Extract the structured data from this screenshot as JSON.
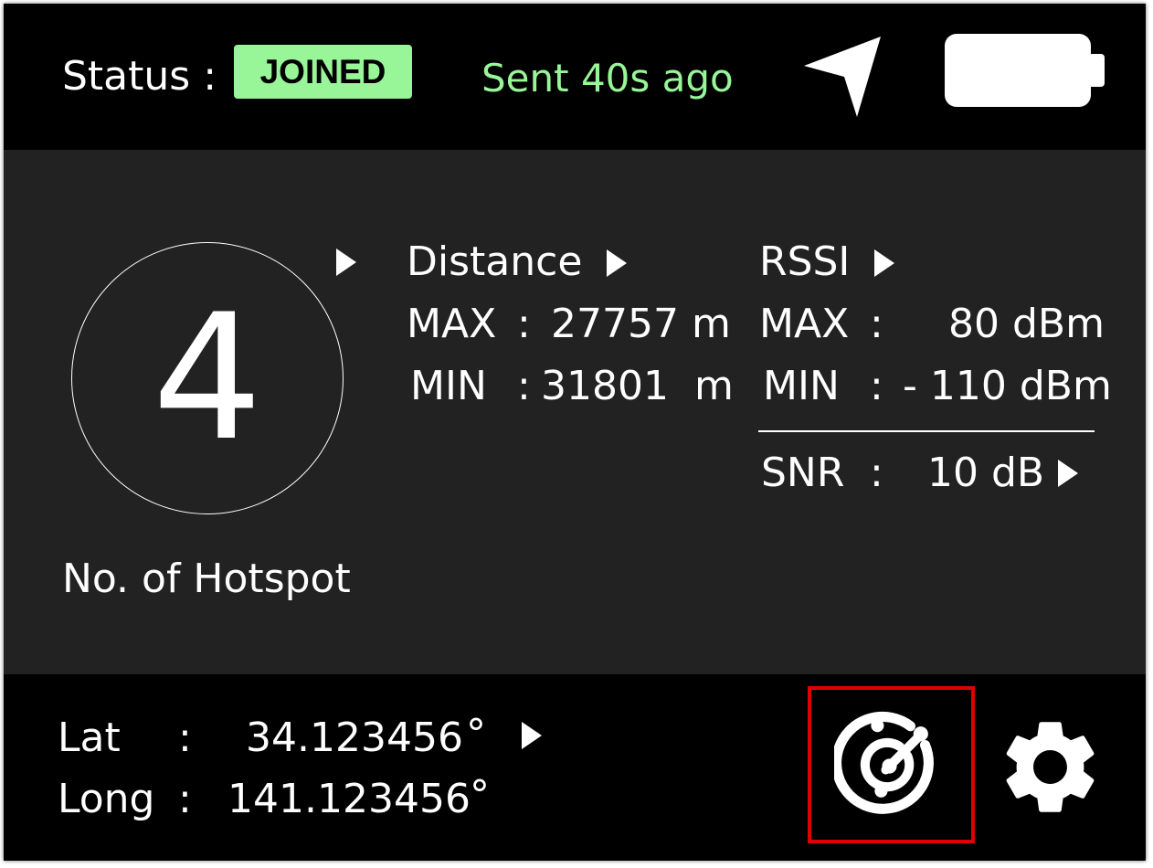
{
  "header": {
    "status_label": "Status :",
    "status_badge": "JOINED",
    "sent_text": "Sent 40s ago",
    "icons": [
      "navigation-arrow-icon",
      "battery-icon"
    ]
  },
  "hotspot": {
    "count": "4",
    "label": "No. of Hotspot"
  },
  "distance": {
    "title": "Distance",
    "max_label": "MAX",
    "max_sep": ":",
    "max_value": "27757 m",
    "min_label": "MIN",
    "min_sep": ":",
    "min_value": "31801  m"
  },
  "rssi": {
    "title": "RSSI",
    "max_label": "MAX",
    "max_sep": ":",
    "max_value": "80 dBm",
    "min_label": "MIN",
    "min_sep": ":",
    "min_value": "- 110 dBm"
  },
  "snr": {
    "label": "SNR",
    "sep": ":",
    "value": "10 dB"
  },
  "location": {
    "lat_label": "Lat",
    "lat_sep": ":",
    "lat_value": "34.123456",
    "lat_unit": "°",
    "long_label": "Long",
    "long_sep": ":",
    "long_value": "141.123456",
    "long_unit": "°"
  },
  "footer_icons": [
    "radar-icon",
    "gear-icon"
  ],
  "colors": {
    "background": "#000000",
    "panel": "#222222",
    "accent_green": "#98f598",
    "highlight_red": "#e00000",
    "text": "#ffffff"
  }
}
